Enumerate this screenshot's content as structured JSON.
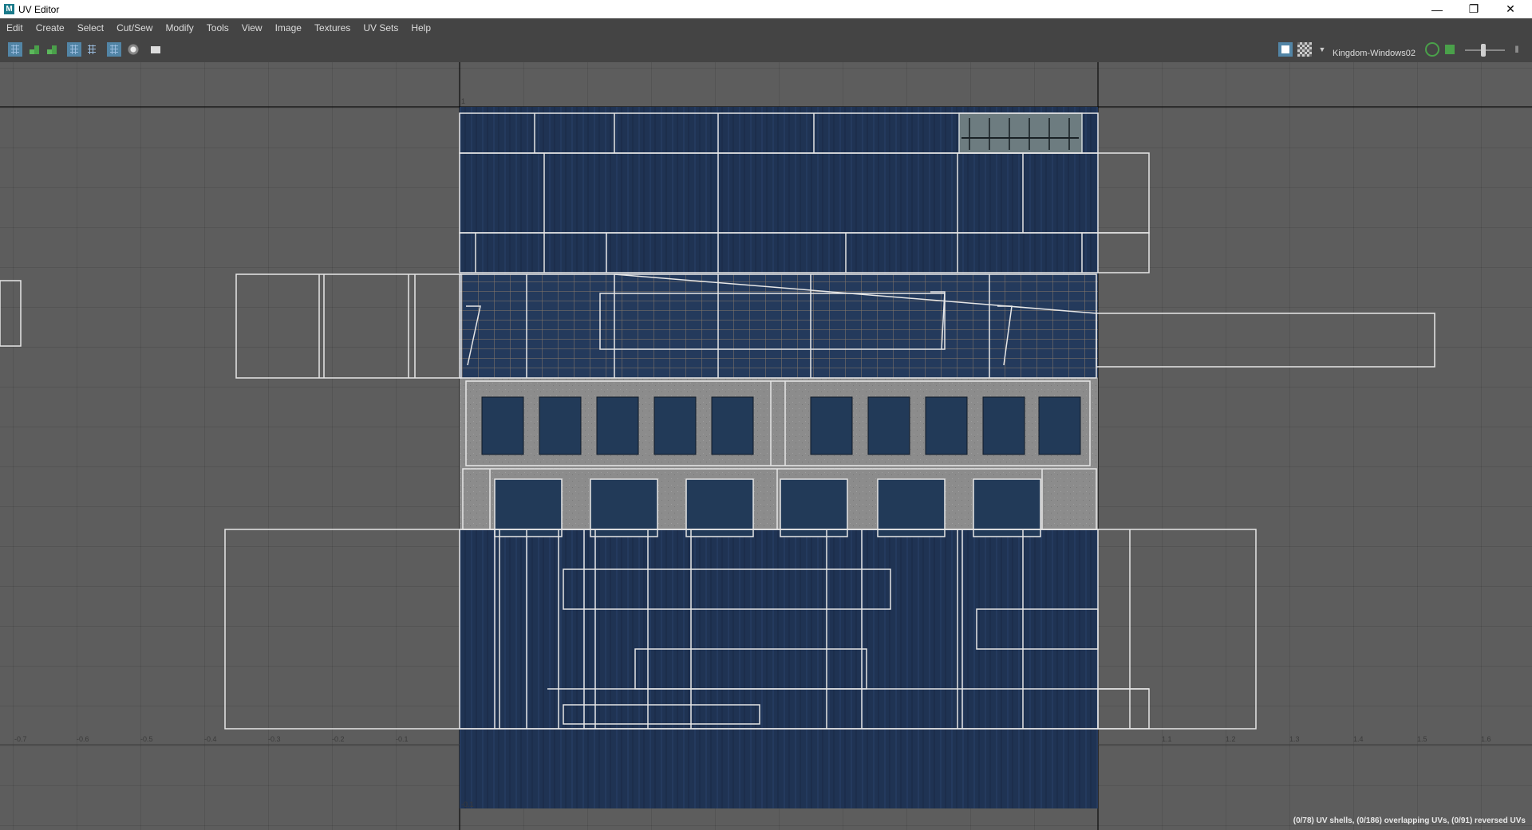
{
  "window": {
    "title": "UV Editor",
    "app_icon_letter": "M",
    "controls": [
      "minimize",
      "restore",
      "close"
    ]
  },
  "menu": [
    "Edit",
    "Create",
    "Select",
    "Cut/Sew",
    "Modify",
    "Tools",
    "View",
    "Image",
    "Textures",
    "UV Sets",
    "Help"
  ],
  "toolbar": {
    "left_icons": [
      "uv-shell-icon",
      "uv-green-icon",
      "uv-green-alt-icon",
      "grid-frame-icon",
      "grid-dotted-icon",
      "grid-toggle-icon",
      "shaded-toggle-icon",
      "snapshot-icon"
    ],
    "right_icons": [
      "texture-display-icon",
      "checker-icon",
      "dropdown-arrow-icon"
    ],
    "uv_set_name": "Kingdom-Windows02",
    "right_tail_icons": [
      "refresh-icon",
      "image-icon",
      "exposure-slider",
      "expand-icon"
    ]
  },
  "axis": {
    "bottom_ticks": [
      "-0.7",
      "-0.6",
      "-0.5",
      "-0.4",
      "-0.3",
      "-0.2",
      "-0.1",
      "1.1",
      "1.2",
      "1.3",
      "1.4",
      "1.5",
      "1.6"
    ],
    "top_mark": "1",
    "bottom_mark": "-0.1"
  },
  "status": "(0/78) UV shells, (0/186) overlapping UVs, (0/91) reversed UVs",
  "colors": {
    "viewport_bg": "#5d5d5d",
    "texture_blue": "#1f3353",
    "uv_line": "#e6e6e6",
    "concrete": "#8c8c8c",
    "window_dark": "#223a58"
  }
}
